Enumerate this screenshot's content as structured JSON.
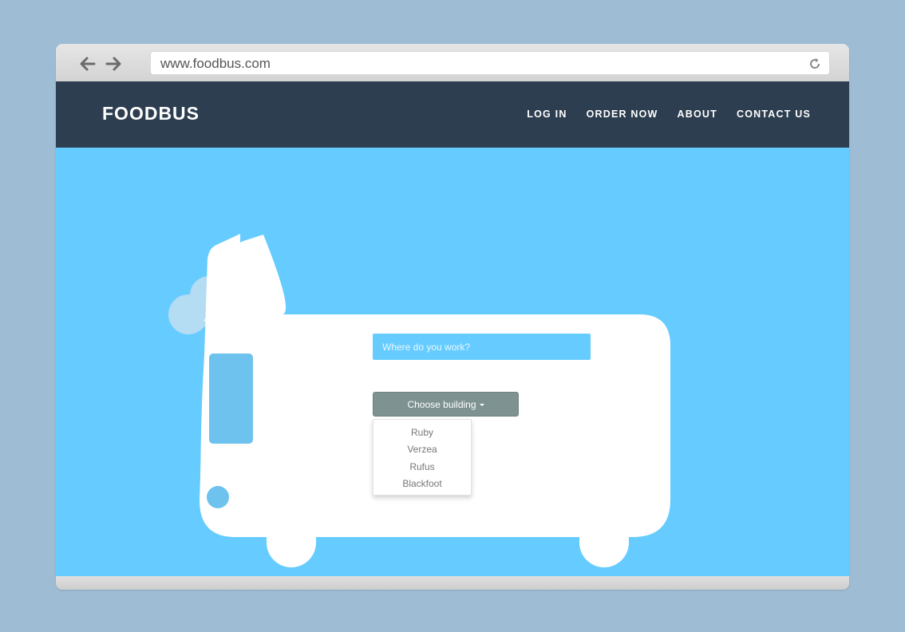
{
  "browser": {
    "url": "www.foodbus.com",
    "icons": [
      "back-arrow-icon",
      "forward-arrow-icon",
      "reload-icon"
    ]
  },
  "nav": {
    "brand": "FOODBUS",
    "items": [
      "LOG IN",
      "ORDER NOW",
      "ABOUT",
      "CONTACT US"
    ]
  },
  "main": {
    "title": "FoodBus",
    "work_input": {
      "placeholder": "Where do you work?",
      "value": ""
    },
    "building_button": "Choose building",
    "building_options": [
      "Ruby",
      "Verzea",
      "Rufus",
      "Blackfoot"
    ]
  },
  "colors": {
    "page_bg": "#9ebcd4",
    "navbar": "#2d3e50",
    "hero": "#66ccff",
    "button": "#7f9292",
    "accent": "#66ccff"
  }
}
